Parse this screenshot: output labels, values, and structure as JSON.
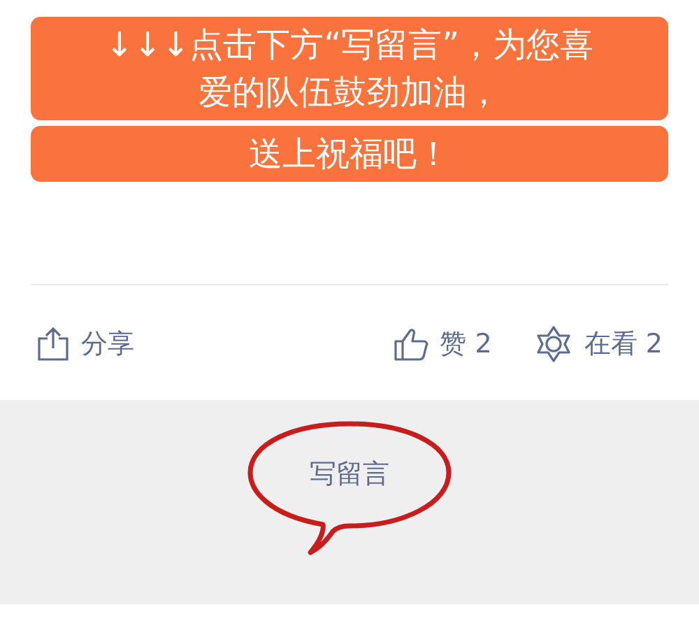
{
  "banners": [
    {
      "lines": [
        "↓↓↓点击下方“写留言”，为您喜",
        "爱的队伍鼓劲加油，"
      ]
    },
    {
      "lines": [
        "送上祝福吧！"
      ]
    }
  ],
  "actions": [
    {
      "kind": "share",
      "label": "分享"
    },
    {
      "kind": "like",
      "label": "赞 2"
    },
    {
      "kind": "watching",
      "label": "在看 2"
    }
  ],
  "comment": {
    "label": "写留言"
  }
}
